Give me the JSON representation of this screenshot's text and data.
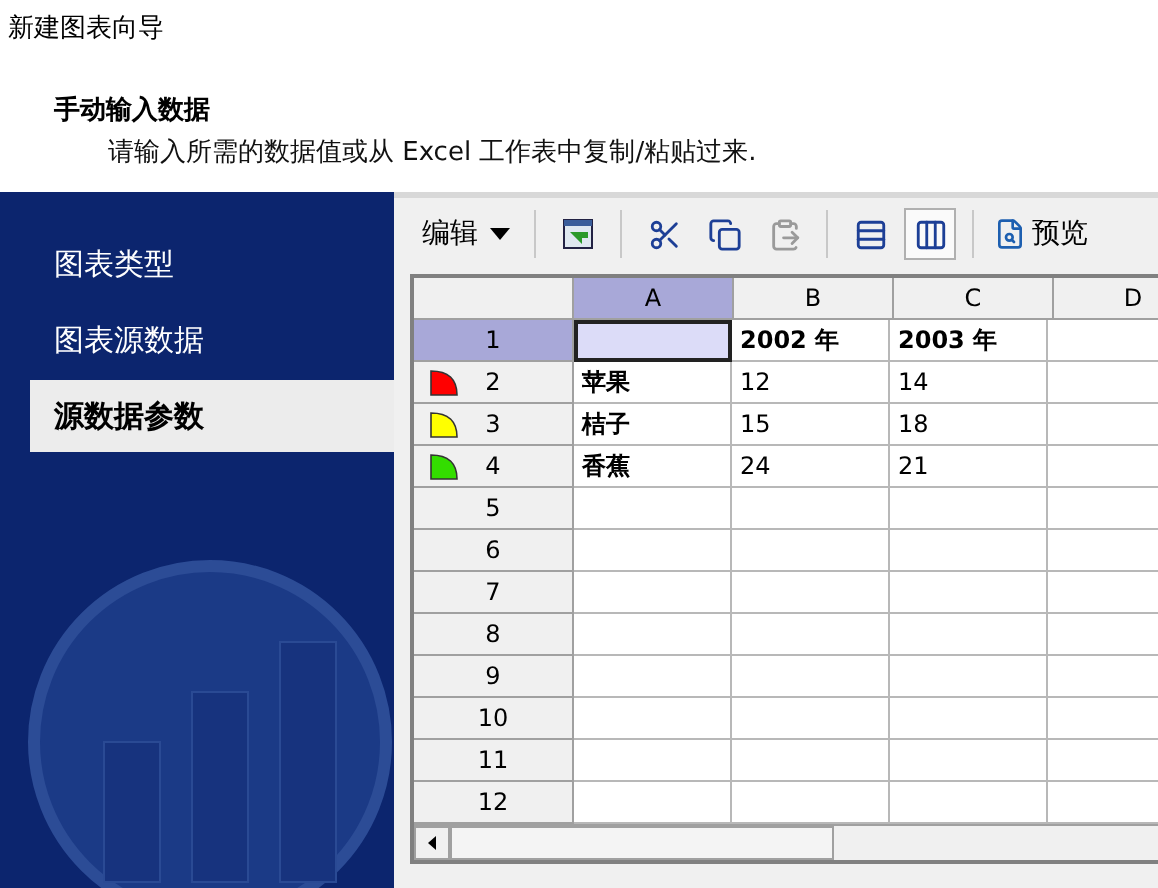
{
  "window": {
    "title": "新建图表向导"
  },
  "header": {
    "title": "手动输入数据",
    "description": "请输入所需的数据值或从 Excel 工作表中复制/粘贴过来."
  },
  "steps": [
    {
      "label": "图表类型",
      "selected": false
    },
    {
      "label": "图表源数据",
      "selected": false
    },
    {
      "label": "源数据参数",
      "selected": true
    }
  ],
  "toolbar": {
    "edit_menu": "编辑",
    "items": [
      {
        "kind": "import",
        "pressed": false,
        "disabled": false
      },
      {
        "kind": "separator"
      },
      {
        "kind": "cut",
        "pressed": false,
        "disabled": false
      },
      {
        "kind": "copy",
        "pressed": false,
        "disabled": false
      },
      {
        "kind": "paste",
        "pressed": false,
        "disabled": true
      },
      {
        "kind": "separator"
      },
      {
        "kind": "rows",
        "pressed": false,
        "disabled": false
      },
      {
        "kind": "columns",
        "pressed": true,
        "disabled": false
      },
      {
        "kind": "separator"
      }
    ],
    "preview": "预览"
  },
  "grid": {
    "columns": [
      {
        "label": "A",
        "selected": true
      },
      {
        "label": "B",
        "selected": false
      },
      {
        "label": "C",
        "selected": false
      },
      {
        "label": "D",
        "selected": false
      }
    ],
    "rows": [
      {
        "label": "1",
        "selected": true,
        "cells": [
          null,
          "2002 年",
          "2003 年"
        ]
      },
      {
        "label": "2",
        "selected": false,
        "color": "#ff0000",
        "cells": [
          "苹果",
          "12",
          "14"
        ]
      },
      {
        "label": "3",
        "selected": false,
        "color": "#ffff00",
        "cells": [
          "桔子",
          "15",
          "18"
        ]
      },
      {
        "label": "4",
        "selected": false,
        "color": "#33dd00",
        "cells": [
          "香蕉",
          "24",
          "21"
        ]
      },
      {
        "label": "5",
        "selected": false
      },
      {
        "label": "6",
        "selected": false
      },
      {
        "label": "7",
        "selected": false
      },
      {
        "label": "8",
        "selected": false
      },
      {
        "label": "9",
        "selected": false
      },
      {
        "label": "10",
        "selected": false
      },
      {
        "label": "11",
        "selected": false
      },
      {
        "label": "12",
        "selected": false
      }
    ]
  }
}
